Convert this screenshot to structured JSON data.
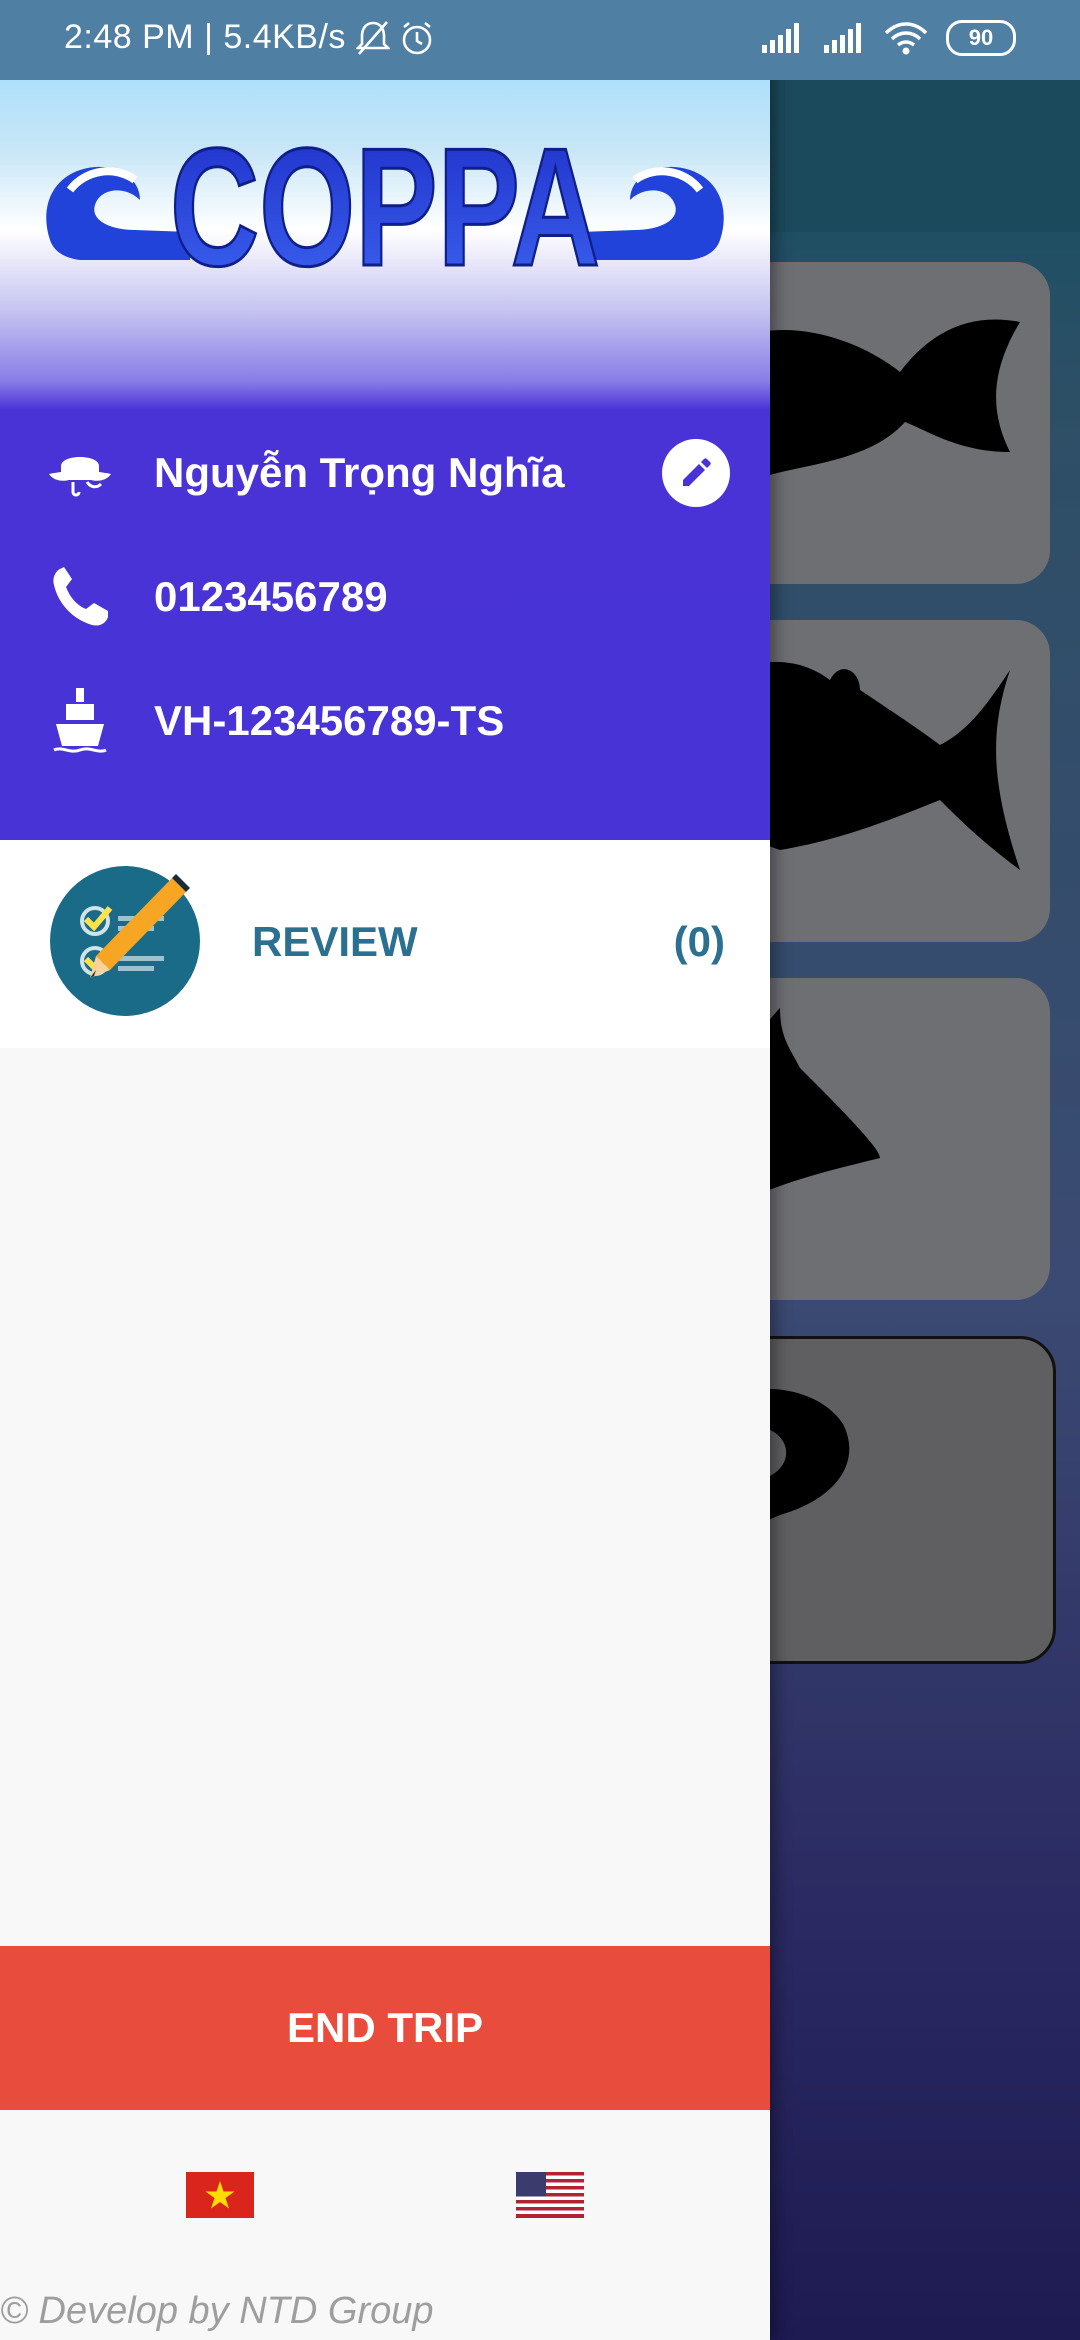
{
  "status_bar": {
    "time_speed": "2:48 PM | 5.4KB/s",
    "battery": "90"
  },
  "drawer": {
    "logo_text": "COPPA",
    "user_name": "Nguyễn Trọng Nghĩa",
    "phone": "0123456789",
    "vessel_id": "VH-123456789-TS",
    "review_label": "REVIEW",
    "review_count": "(0)",
    "end_trip_label": "END TRIP",
    "footer": "© Develop by NTD Group"
  },
  "colors": {
    "header_purple": "#4733d6",
    "accent_teal": "#2b7090",
    "end_trip_red": "#e84c3d"
  },
  "icons": [
    "fisherman-hat-icon",
    "phone-icon",
    "ship-icon",
    "edit-pencil-icon",
    "review-checklist-icon",
    "vietnam-flag-icon",
    "usa-flag-icon"
  ]
}
